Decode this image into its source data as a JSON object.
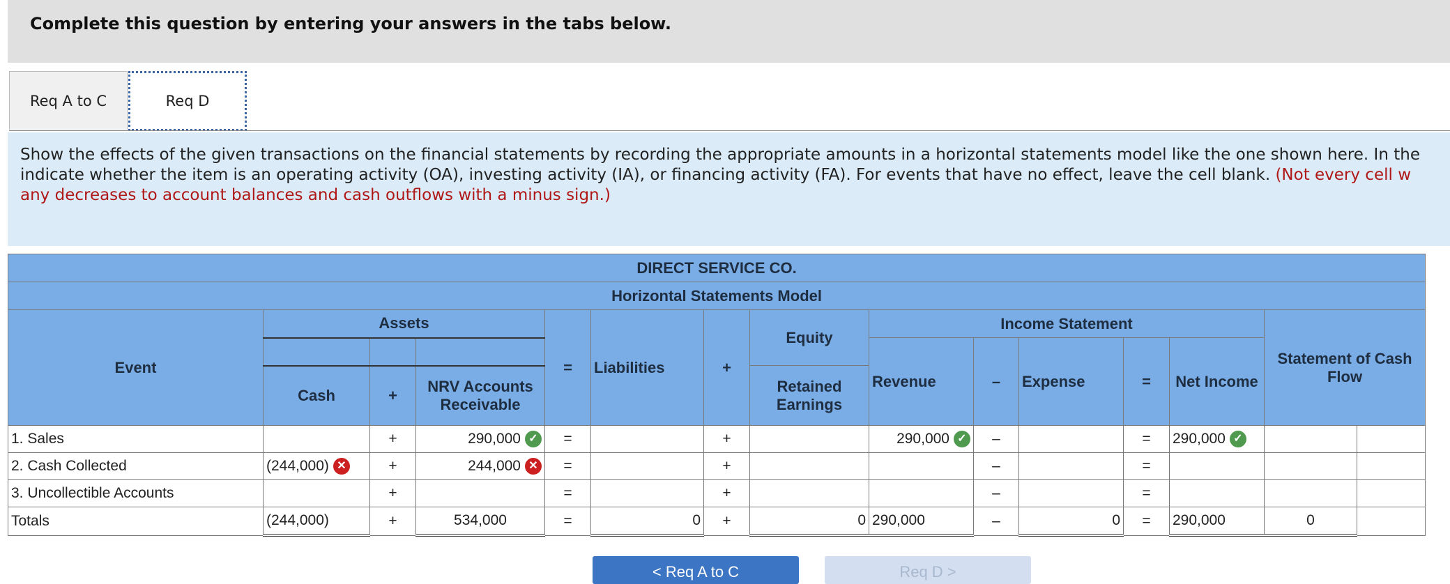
{
  "header": {
    "title": "Complete this question by entering your answers in the tabs below."
  },
  "tabs": [
    {
      "label": "Req A to C",
      "active": false
    },
    {
      "label": "Req D",
      "active": true
    }
  ],
  "instructions": {
    "line1": "Show the effects of the given transactions on the financial statements by recording the appropriate amounts in a horizontal statements model like the one shown here. In the",
    "line2_black": "indicate whether the item is an operating activity (OA), investing activity (IA), or financing activity (FA). For events that have no effect, leave the cell blank.",
    "line2_red": "(Not every cell w",
    "line3_red": "any decreases to account balances and cash outflows with a minus sign.)"
  },
  "model": {
    "company": "DIRECT SERVICE CO.",
    "title": "Horizontal Statements Model",
    "headers": {
      "event": "Event",
      "assets": "Assets",
      "cash": "Cash",
      "plus": "+",
      "nrv": "NRV Accounts Receivable",
      "equals": "=",
      "liabilities": "Liabilities",
      "equity": "Equity",
      "retained": "Retained Earnings",
      "income_statement": "Income Statement",
      "revenue": "Revenue",
      "minus": "–",
      "expense": "Expense",
      "net_income": "Net Income",
      "cash_flow": "Statement of Cash Flow"
    },
    "rows": [
      {
        "event": "1. Sales",
        "cash": "",
        "nrv": "290,000",
        "nrv_mark": "ok",
        "liabilities": "",
        "retained": "",
        "revenue": "290,000",
        "revenue_mark": "ok",
        "expense": "",
        "net_income": "290,000",
        "net_mark": "ok",
        "cf_amount": "",
        "cf_type": ""
      },
      {
        "event": "2. Cash Collected",
        "cash": "(244,000)",
        "cash_mark": "bad",
        "nrv": "244,000",
        "nrv_mark": "bad",
        "liabilities": "",
        "retained": "",
        "revenue": "",
        "expense": "",
        "net_income": "",
        "cf_amount": "",
        "cf_type": ""
      },
      {
        "event": "3. Uncollectible Accounts",
        "cash": "",
        "nrv": "",
        "liabilities": "",
        "retained": "",
        "revenue": "",
        "expense": "",
        "net_income": "",
        "cf_amount": "",
        "cf_type": ""
      }
    ],
    "totals": {
      "event": "Totals",
      "cash": "(244,000)",
      "nrv": "534,000",
      "liabilities": "0",
      "retained": "0",
      "revenue": "290,000",
      "expense": "0",
      "net_income": "290,000",
      "cf_amount": "0",
      "cf_type": ""
    }
  },
  "buttons": {
    "prev": "< Req A to C",
    "next": "Req D >"
  }
}
